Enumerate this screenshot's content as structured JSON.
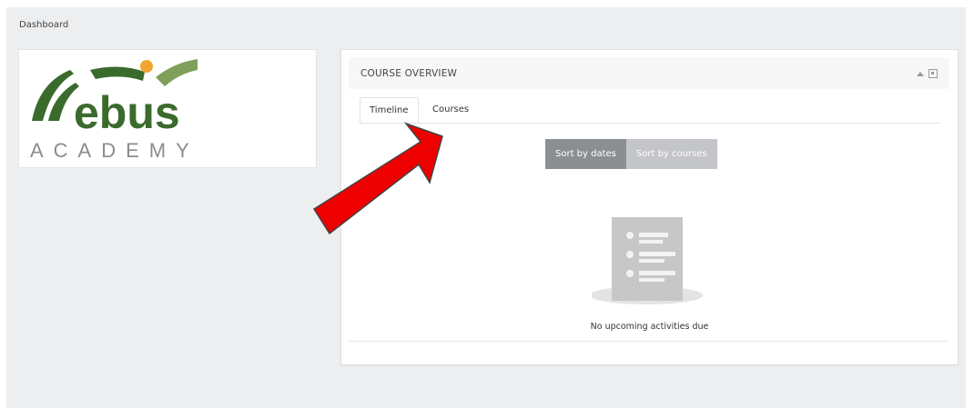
{
  "breadcrumb": {
    "label": "Dashboard"
  },
  "logo": {
    "word": "ebus",
    "subtitle": "ACADEMY",
    "colors": {
      "dark_green": "#3a6b2c",
      "light_green": "#7f9f5a",
      "orange": "#f0a531",
      "grey": "#8a8c8e"
    }
  },
  "course_overview": {
    "title": "COURSE OVERVIEW",
    "tabs": [
      {
        "label": "Timeline",
        "active": true
      },
      {
        "label": "Courses",
        "active": false
      }
    ],
    "sort_buttons": [
      {
        "label": "Sort by dates",
        "active": true
      },
      {
        "label": "Sort by courses",
        "active": false
      }
    ],
    "empty_message": "No upcoming activities due"
  },
  "annotation": {
    "arrow_color": "#ee0000"
  }
}
